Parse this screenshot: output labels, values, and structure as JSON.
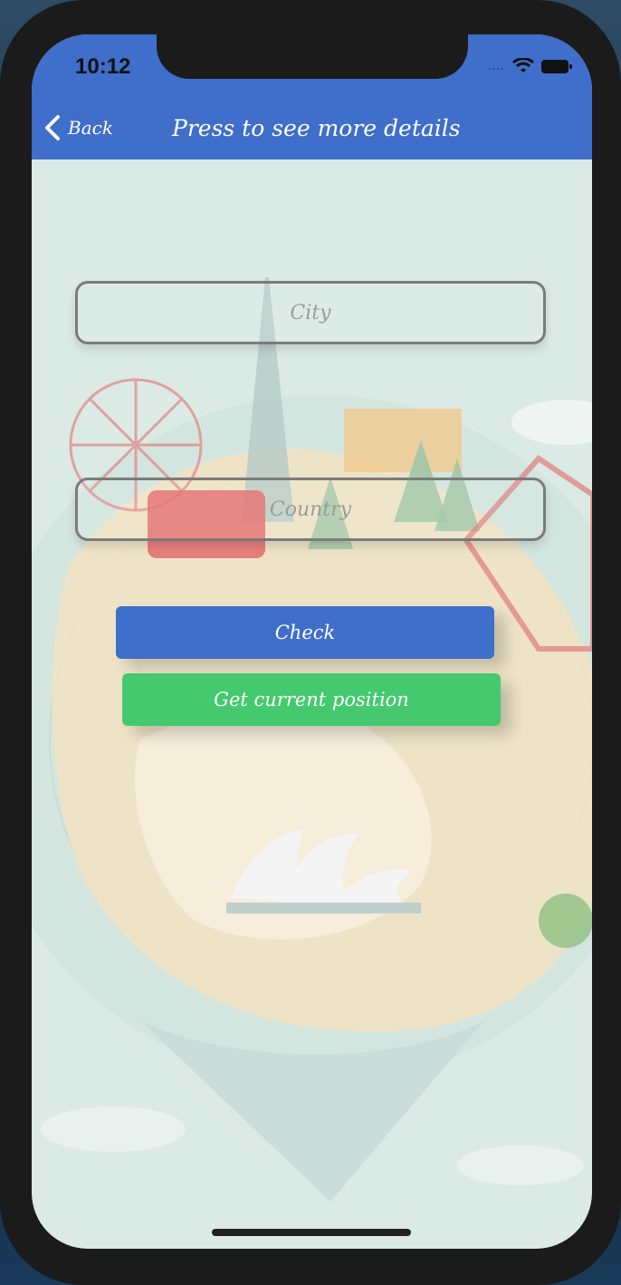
{
  "status_bar": {
    "time": "10:12",
    "signal": "....",
    "icons": [
      "wifi-icon",
      "battery-icon"
    ]
  },
  "nav": {
    "back_label": "Back",
    "title": "Press to see more details"
  },
  "form": {
    "city_placeholder": "City",
    "country_placeholder": "Country"
  },
  "buttons": {
    "check_label": "Check",
    "position_label": "Get current position"
  },
  "colors": {
    "header": "#3f6ecb",
    "check_button": "#3f6ecb",
    "position_button": "#45c96e",
    "background": "#dbeae4"
  }
}
